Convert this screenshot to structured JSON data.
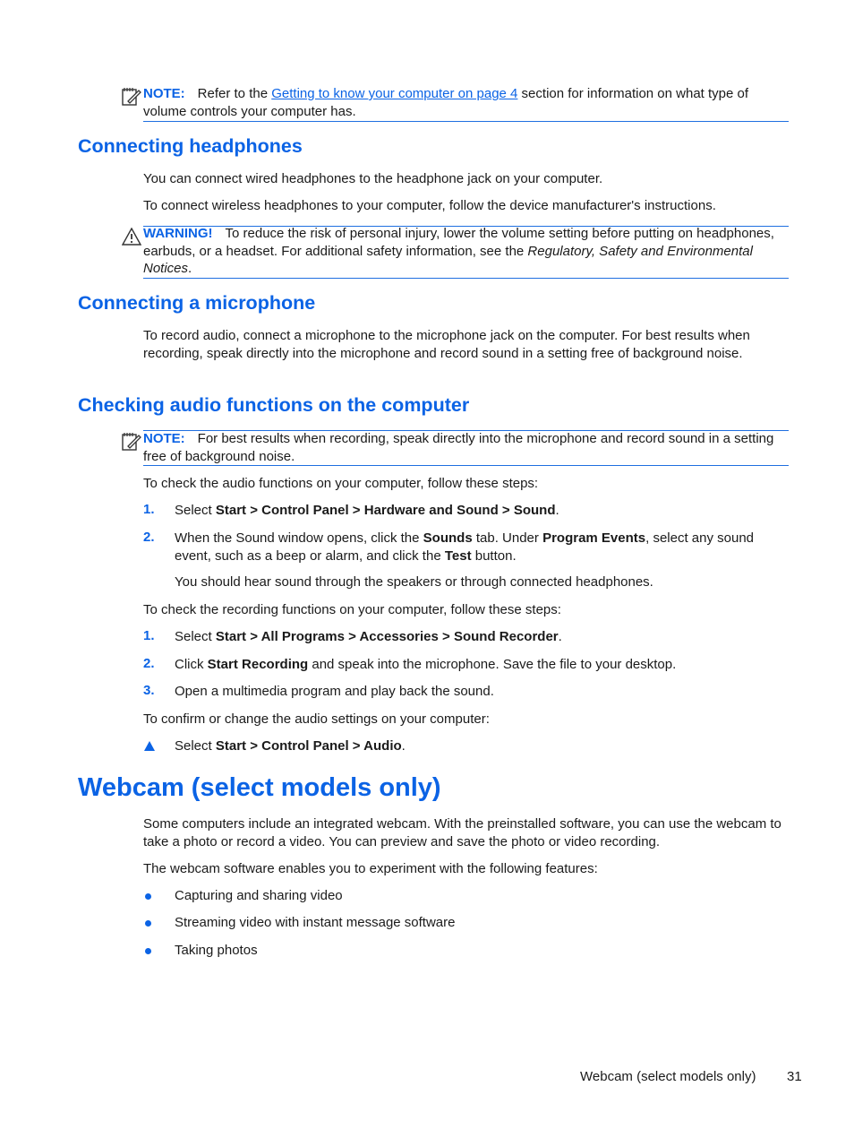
{
  "note1": {
    "label": "NOTE:",
    "text_before": "Refer to the ",
    "link": "Getting to know your computer on page 4",
    "text_after": " section for information on what type of volume controls your computer has."
  },
  "section_headphones": {
    "title": "Connecting headphones",
    "para1": "You can connect wired headphones to the headphone jack on your computer.",
    "para2": "To connect wireless headphones to your computer, follow the device manufacturer's instructions.",
    "warning": {
      "label": "WARNING!",
      "text": "To reduce the risk of personal injury, lower the volume setting before putting on headphones, earbuds, or a headset. For additional safety information, see the ",
      "italic": "Regulatory, Safety and Environmental Notices",
      "end": "."
    }
  },
  "section_microphone": {
    "title": "Connecting a microphone",
    "para": "To record audio, connect a microphone to the microphone jack on the computer. For best results when recording, speak directly into the microphone and record sound in a setting free of background noise."
  },
  "section_audio": {
    "title": "Checking audio functions on the computer",
    "note": {
      "label": "NOTE:",
      "text": "For best results when recording, speak directly into the microphone and record sound in a setting free of background noise."
    },
    "intro1": "To check the audio functions on your computer, follow these steps:",
    "steps1": [
      {
        "num": "1.",
        "pre": "Select ",
        "bold": "Start > Control Panel > Hardware and Sound > Sound",
        "post": "."
      },
      {
        "num": "2.",
        "t1": "When the Sound window opens, click the ",
        "b1": "Sounds",
        "t2": " tab. Under ",
        "b2": "Program Events",
        "t3": ", select any sound event, such as a beep or alarm, and click the ",
        "b3": "Test",
        "t4": " button."
      }
    ],
    "steps1_followup": "You should hear sound through the speakers or through connected headphones.",
    "intro2": "To check the recording functions on your computer, follow these steps:",
    "steps2": [
      {
        "num": "1.",
        "pre": "Select ",
        "bold": "Start > All Programs > Accessories > Sound Recorder",
        "post": "."
      },
      {
        "num": "2.",
        "pre": "Click ",
        "bold": "Start Recording",
        "post": " and speak into the microphone. Save the file to your desktop."
      },
      {
        "num": "3.",
        "pre": "Open a multimedia program and play back the sound.",
        "bold": "",
        "post": ""
      }
    ],
    "intro3": "To confirm or change the audio settings on your computer:",
    "single_step": {
      "pre": "Select ",
      "bold": "Start > Control Panel > Audio",
      "post": "."
    }
  },
  "section_webcam": {
    "title": "Webcam (select models only)",
    "para1": "Some computers include an integrated webcam. With the preinstalled software, you can use the webcam to take a photo or record a video. You can preview and save the photo or video recording.",
    "para2": "The webcam software enables you to experiment with the following features:",
    "bullets": [
      "Capturing and sharing video",
      "Streaming video with instant message software",
      "Taking photos"
    ]
  },
  "footer": {
    "section": "Webcam (select models only)",
    "page": "31"
  }
}
